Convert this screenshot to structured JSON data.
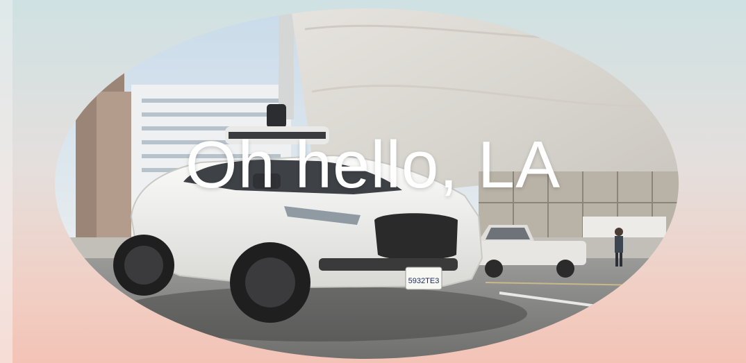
{
  "headline": "Oh hello, LA",
  "license_plate": "5932TE3",
  "colors": {
    "background_top": "#cfe1e3",
    "background_bottom": "#f3c3b6",
    "headline": "#ffffff",
    "car_body": "#f2f2f0"
  }
}
